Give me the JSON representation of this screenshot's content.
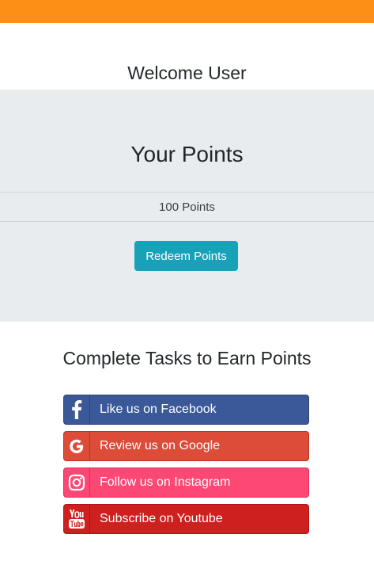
{
  "colors": {
    "topbar": "#fd8f17",
    "panel": "#e8ecef",
    "redeem": "#17a2b8",
    "facebook": "#3b5998",
    "google": "#dd4b39",
    "instagram": "#fd4774",
    "youtube": "#cd201f"
  },
  "welcome": "Welcome User",
  "points": {
    "title": "Your Points",
    "value": "100 Points",
    "redeem_label": "Redeem Points"
  },
  "tasks": {
    "title": "Complete Tasks to Earn Points",
    "buttons": [
      {
        "icon": "facebook-icon",
        "label": "Like us on Facebook"
      },
      {
        "icon": "google-icon",
        "label": "Review us on Google"
      },
      {
        "icon": "instagram-icon",
        "label": "Follow us on Instagram"
      },
      {
        "icon": "youtube-icon",
        "label": "Subscribe on Youtube"
      }
    ]
  }
}
